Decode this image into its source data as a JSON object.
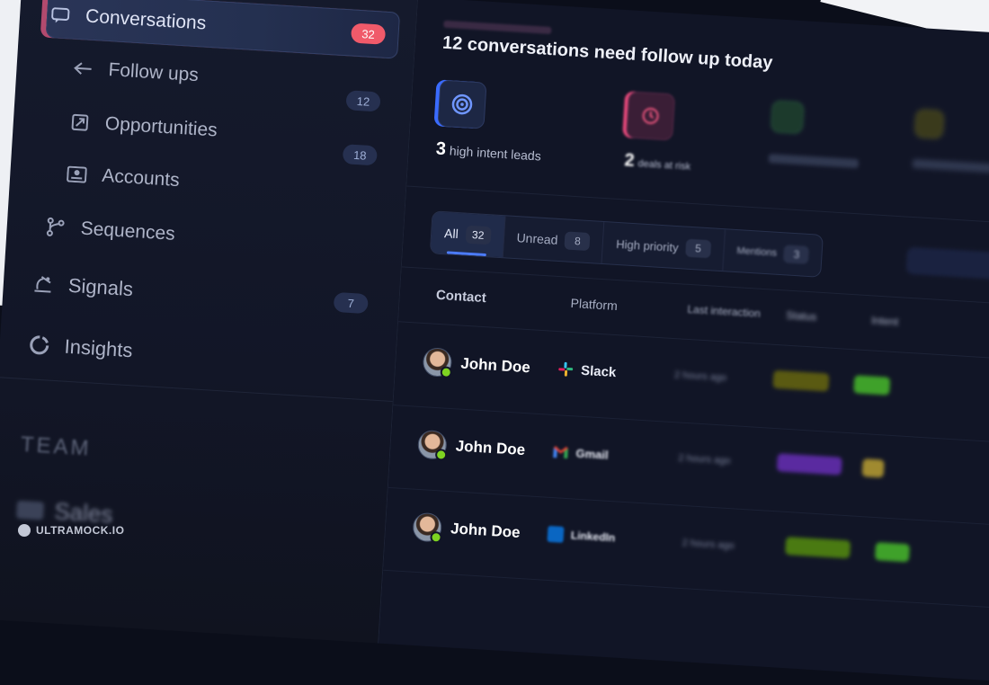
{
  "sidebar": {
    "items": [
      {
        "label": "Conversations",
        "badge": "32",
        "icon": "chat-icon",
        "active": true
      },
      {
        "label": "Follow ups",
        "badge": "12",
        "icon": "reply-icon"
      },
      {
        "label": "Opportunities",
        "badge": "18",
        "icon": "opportunity-icon"
      },
      {
        "label": "Accounts",
        "badge": "",
        "icon": "id-card-icon"
      },
      {
        "label": "Sequences",
        "badge": "",
        "icon": "branch-icon"
      },
      {
        "label": "Signals",
        "badge": "7",
        "icon": "signal-icon"
      },
      {
        "label": "Insights",
        "badge": "",
        "icon": "donut-icon"
      }
    ],
    "team_label": "TEAM",
    "team_item": "Sales"
  },
  "header": {
    "headline": "12 conversations need follow up today"
  },
  "stats": [
    {
      "value": "3",
      "label": "high intent leads",
      "icon": "target-icon"
    },
    {
      "value": "2",
      "label": "deals at risk",
      "icon": "clock-icon"
    }
  ],
  "tabs": [
    {
      "label": "All",
      "count": "32",
      "active": true
    },
    {
      "label": "Unread",
      "count": "8"
    },
    {
      "label": "High priority",
      "count": "5"
    },
    {
      "label": "Mentions",
      "count": "3"
    }
  ],
  "table": {
    "columns": [
      "Contact",
      "Platform",
      "Last interaction",
      "Status",
      "Intent"
    ],
    "rows": [
      {
        "contact": "John Doe",
        "platform": "Slack",
        "platform_icon": "slack-icon",
        "last": "2 hours ago"
      },
      {
        "contact": "John Doe",
        "platform": "Gmail",
        "platform_icon": "gmail-icon",
        "last": "2 hours ago"
      },
      {
        "contact": "John Doe",
        "platform": "LinkedIn",
        "platform_icon": "linkedin-icon",
        "last": "2 hours ago"
      }
    ]
  },
  "watermark": "ULTRAMOCK.IO",
  "colors": {
    "accent": "#4c7cff",
    "badge_red": "#f05a6a",
    "online": "#7ed321"
  }
}
